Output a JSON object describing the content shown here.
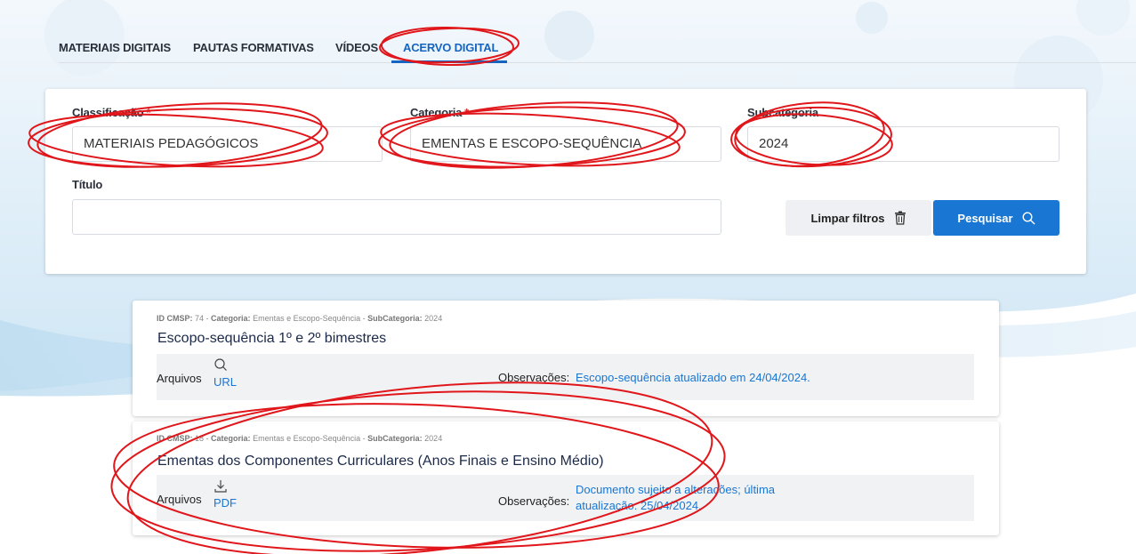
{
  "tabs": [
    {
      "label": "MATERIAIS DIGITAIS"
    },
    {
      "label": "PAUTAS FORMATIVAS"
    },
    {
      "label": "VÍDEOS"
    },
    {
      "label": "ACERVO DIGITAL",
      "active": true
    }
  ],
  "filters": {
    "classificacao": {
      "label": "Classificação",
      "required_mark": "*",
      "value": "MATERIAIS PEDAGÓGICOS"
    },
    "categoria": {
      "label": "Categoria",
      "required_mark": "*",
      "value": "EMENTAS E ESCOPO-SEQUÊNCIA"
    },
    "subcategoria": {
      "label": "Subcategoria",
      "value": "2024"
    },
    "titulo": {
      "label": "Título",
      "value": ""
    },
    "clear_label": "Limpar filtros",
    "search_label": "Pesquisar"
  },
  "results": [
    {
      "meta_id_label": "ID CMSP:",
      "meta_id": "74",
      "meta_cat_label": "Categoria:",
      "meta_cat": "Ementas e Escopo-Sequência",
      "meta_sub_label": "SubCategoria:",
      "meta_sub": "2024",
      "title": "Escopo-sequência 1º e 2º bimestres",
      "files_label": "Arquivos",
      "file_type": "URL",
      "file_icon": "search-icon",
      "obs_label": "Observações:",
      "obs": "Escopo-sequência atualizado em 24/04/2024."
    },
    {
      "meta_id_label": "ID CMSP:",
      "meta_id": "18",
      "meta_cat_label": "Categoria:",
      "meta_cat": "Ementas e Escopo-Sequência",
      "meta_sub_label": "SubCategoria:",
      "meta_sub": "2024",
      "title": "Ementas dos Componentes Curriculares (Anos Finais e Ensino Médio)",
      "files_label": "Arquivos",
      "file_type": "PDF",
      "file_icon": "download-icon",
      "obs_label": "Observações:",
      "obs_line1": "Documento sujeito a alterações; última",
      "obs_line2": "atualização: 25/04/2024."
    }
  ],
  "colors": {
    "accent": "#1976d2",
    "annotation": "#e0161b",
    "background_wave": "#d6ebf7"
  }
}
